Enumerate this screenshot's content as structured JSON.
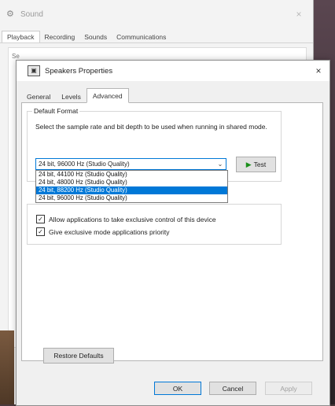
{
  "sound_window": {
    "title": "Sound",
    "close": "×",
    "tabs": [
      {
        "label": "Playback"
      },
      {
        "label": "Recording"
      },
      {
        "label": "Sounds"
      },
      {
        "label": "Communications"
      }
    ],
    "body_label": "Se"
  },
  "dialog": {
    "title": "Speakers Properties",
    "close": "×",
    "tabs": [
      {
        "label": "General"
      },
      {
        "label": "Levels"
      },
      {
        "label": "Advanced"
      }
    ],
    "active_tab": "Advanced"
  },
  "default_format": {
    "group_label": "Default Format",
    "description": "Select the sample rate and bit depth to be used when running in shared mode.",
    "selected_value": "24 bit, 96000 Hz (Studio Quality)",
    "test_label": "Test",
    "options": [
      {
        "label": "24 bit, 44100 Hz (Studio Quality)"
      },
      {
        "label": "24 bit, 48000 Hz (Studio Quality)"
      },
      {
        "label": "24 bit, 88200 Hz (Studio Quality)"
      },
      {
        "label": "24 bit, 96000 Hz (Studio Quality)"
      }
    ],
    "highlighted_option": "24 bit, 88200 Hz (Studio Quality)"
  },
  "exclusive_mode": {
    "allow_label": "Allow applications to take exclusive control of this device",
    "allow_checked": true,
    "priority_label": "Give exclusive mode applications priority",
    "priority_checked": true
  },
  "buttons": {
    "restore_defaults": "Restore Defaults",
    "ok": "OK",
    "cancel": "Cancel",
    "apply": "Apply"
  },
  "icons": {
    "sound_icon": "speaker-icon",
    "dialog_icon": "speaker-properties-icon",
    "test_icon": "play-icon",
    "dropdown_icon": "chevron-down-icon",
    "check_icon": "checkmark-icon"
  },
  "colors": {
    "accent": "#0078d7",
    "test_play": "#1a8f1a"
  }
}
